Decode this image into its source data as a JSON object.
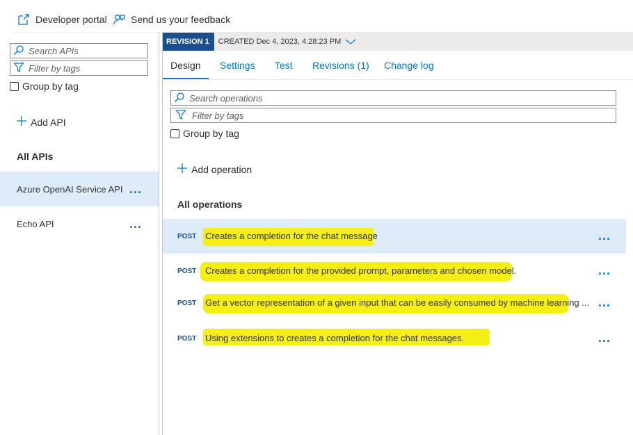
{
  "toolbar": {
    "developer_portal": "Developer portal",
    "feedback": "Send us your feedback"
  },
  "left": {
    "search_placeholder": "Search APIs",
    "filter_placeholder": "Filter by tags",
    "group_by_tag": "Group by tag",
    "add_api": "Add API",
    "all_apis": "All APIs",
    "apis": [
      {
        "name": "Azure OpenAI Service API",
        "selected": true
      },
      {
        "name": "Echo API",
        "selected": false
      }
    ]
  },
  "revision": {
    "badge": "REVISION 1",
    "created": "CREATED Dec 4, 2023, 4:28:23 PM"
  },
  "tabs": [
    "Design",
    "Settings",
    "Test",
    "Revisions (1)",
    "Change log"
  ],
  "operations_panel": {
    "search_placeholder": "Search operations",
    "filter_placeholder": "Filter by tags",
    "group_by_tag": "Group by tag",
    "add_operation": "Add operation",
    "all_operations": "All operations",
    "operations": [
      {
        "method": "POST",
        "name": "Creates a completion for the chat message",
        "selected": true
      },
      {
        "method": "POST",
        "name": "Creates a completion for the provided prompt, parameters and chosen model.",
        "selected": false
      },
      {
        "method": "POST",
        "name": "Get a vector representation of a given input that can be easily consumed by machine learning ...",
        "selected": false
      },
      {
        "method": "POST",
        "name": "Using extensions to creates a completion for the chat messages.",
        "selected": false
      }
    ]
  },
  "more_glyph": "...",
  "colors": {
    "accent": "#0078d4",
    "selected_bg": "#deecf9",
    "revision_badge": "#1a4f8b",
    "highlight": "#f5ef13"
  }
}
